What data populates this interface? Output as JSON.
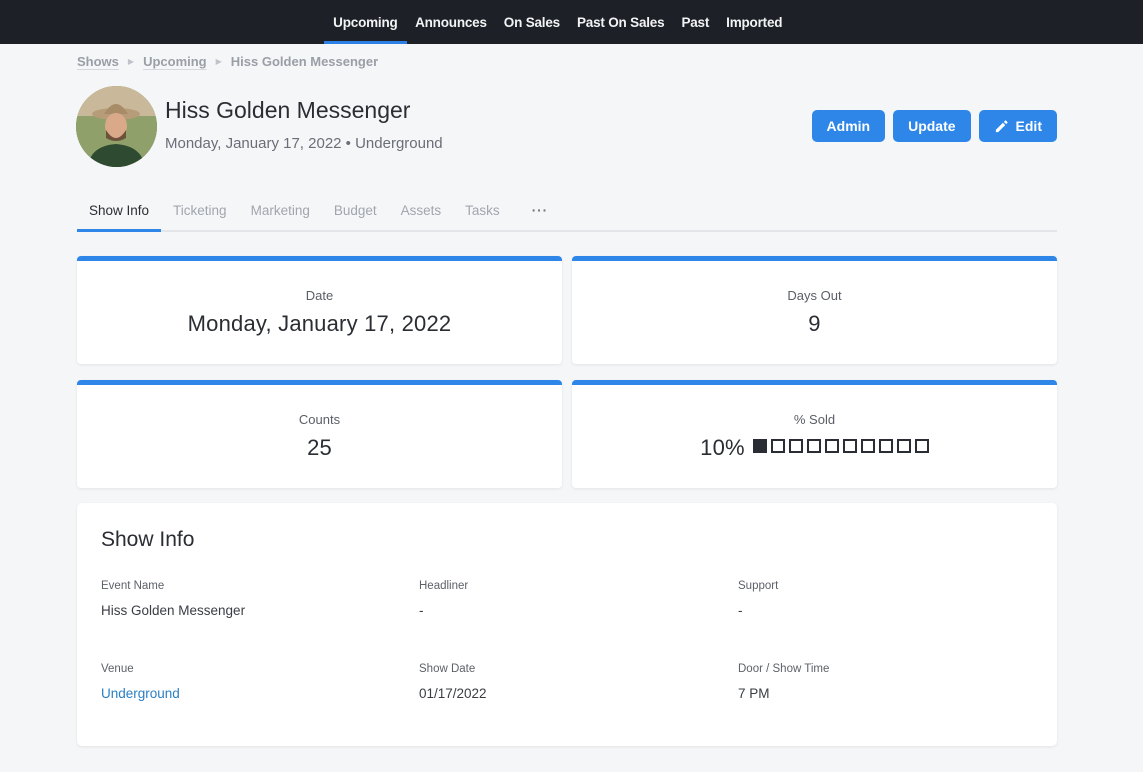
{
  "nav": {
    "items": [
      {
        "label": "Upcoming",
        "active": true
      },
      {
        "label": "Announces"
      },
      {
        "label": "On Sales"
      },
      {
        "label": "Past On Sales"
      },
      {
        "label": "Past"
      },
      {
        "label": "Imported"
      }
    ],
    "accent_color": "#2d7fe3"
  },
  "breadcrumb": {
    "items": [
      "Shows",
      "Upcoming"
    ],
    "current": "Hiss Golden Messenger"
  },
  "header": {
    "title": "Hiss Golden Messenger",
    "subtitle": "Monday, January 17, 2022 • Underground",
    "avatar_icon": "artist-photo"
  },
  "actions": {
    "admin_label": "Admin",
    "update_label": "Update",
    "edit_label": "Edit",
    "edit_icon": "pencil-icon"
  },
  "tabs": [
    {
      "label": "Show Info",
      "active": true
    },
    {
      "label": "Ticketing"
    },
    {
      "label": "Marketing"
    },
    {
      "label": "Budget"
    },
    {
      "label": "Assets"
    },
    {
      "label": "Tasks"
    },
    {
      "label": "···"
    }
  ],
  "stats": {
    "date": {
      "label": "Date",
      "value": "Monday, January 17, 2022"
    },
    "days_out": {
      "label": "Days Out",
      "value": "9"
    },
    "counts": {
      "label": "Counts",
      "value": "25"
    },
    "sold": {
      "label": "% Sold",
      "value": "10%",
      "fraction": 0.1,
      "boxes_total": 10,
      "boxes_filled": 1
    }
  },
  "show_info": {
    "title": "Show Info",
    "fields": [
      {
        "label": "Event Name",
        "value": "Hiss Golden Messenger"
      },
      {
        "label": "Headliner",
        "value": "-"
      },
      {
        "label": "Support",
        "value": "-"
      },
      {
        "label": "Venue",
        "value": "Underground",
        "link": true
      },
      {
        "label": "Show Date",
        "value": "01/17/2022"
      },
      {
        "label": "Door / Show Time",
        "value": "7 PM"
      }
    ]
  },
  "colors": {
    "primary": "#2d86e8",
    "nav_bg": "#1d2026",
    "page_bg": "#f5f6f8",
    "link": "#2a7fc4"
  }
}
